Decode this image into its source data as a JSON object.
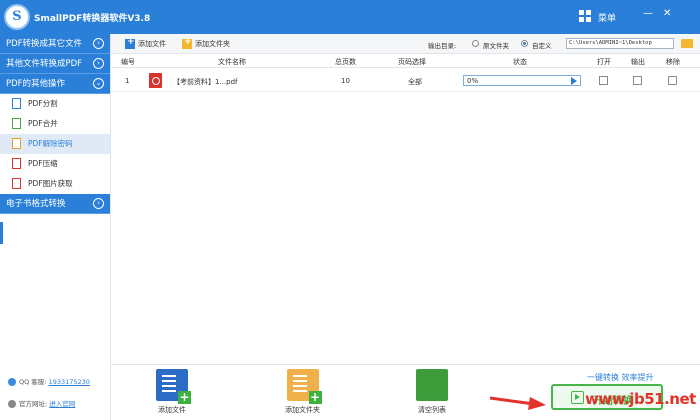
{
  "app": {
    "title": "SmallPDF转换器软件V3.8",
    "logo_letter": "S",
    "menu_label": "菜单",
    "minimize": "—",
    "close": "✕"
  },
  "sidebar": {
    "sections": [
      {
        "label": "PDF转换成其它文件",
        "chevron": "›"
      },
      {
        "label": "其他文件转换成PDF",
        "chevron": "›"
      },
      {
        "label": "PDF的其他操作",
        "chevron": "⌄"
      }
    ],
    "items": [
      {
        "label": "PDF分割"
      },
      {
        "label": "PDF合并"
      },
      {
        "label": "PDF解除密码"
      },
      {
        "label": "PDF压缩"
      },
      {
        "label": "PDF图片获取"
      }
    ],
    "ebook": {
      "label": "电子书格式转换",
      "chevron": "›"
    },
    "contact": {
      "qq_label": "QQ 客服:",
      "qq": "1933175230",
      "site_label": "官方网址:",
      "site": "进入官网"
    }
  },
  "toolbar": {
    "add_file": "添加文件",
    "add_folder": "添加文件夹",
    "output_dir_label": "输出目录:",
    "option_source": "原文件夹",
    "option_custom": "自定义",
    "path": "C:\\Users\\ADMINI~1\\Desktop"
  },
  "table": {
    "headers": [
      "编号",
      "文件名称",
      "总页数",
      "页码选择",
      "状态",
      "打开",
      "输出",
      "移除"
    ],
    "rows": [
      {
        "num": "1",
        "name": "【考前资料】1...pdf",
        "pages": "10",
        "range": "全部",
        "progress": "0%",
        "progress_value": 0
      }
    ]
  },
  "bottom": {
    "add_file": "添加文件",
    "add_folder": "添加文件夹",
    "clear": "清空列表",
    "slogan": "一键转换  效率提升",
    "start": "开始转换"
  },
  "watermark": "www.jb51.net",
  "colors": {
    "primary": "#2a7fd8",
    "green": "#46b64a",
    "pdf_red": "#d8322a"
  }
}
